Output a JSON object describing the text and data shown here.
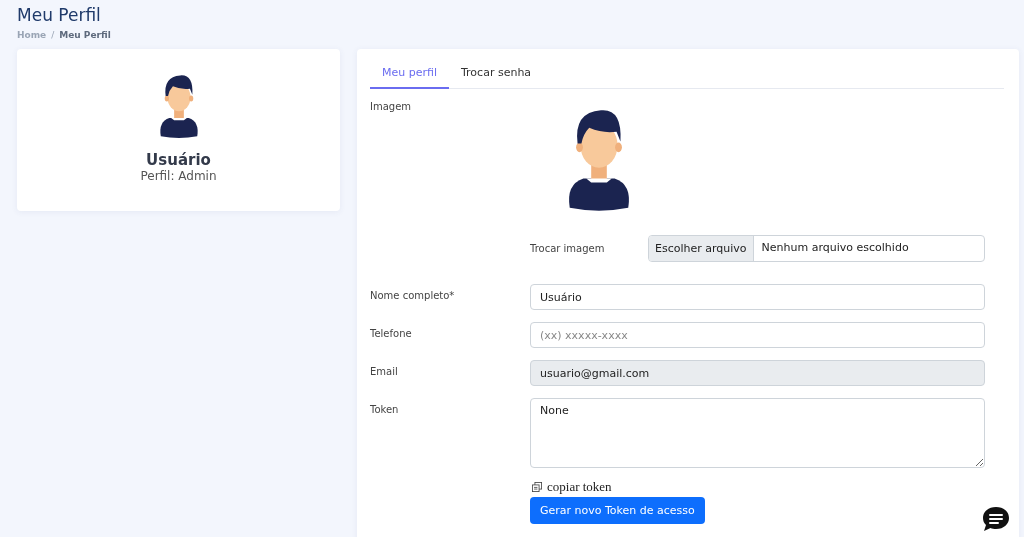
{
  "page": {
    "title": "Meu Perfil"
  },
  "breadcrumb_separator": "/",
  "breadcrumb": [
    {
      "label": "Home",
      "current": false
    },
    {
      "label": "Meu Perfil",
      "current": true
    }
  ],
  "profile_card": {
    "name": "Usuário",
    "role": "Perfil: Admin"
  },
  "tabs": [
    {
      "label": "Meu perfil",
      "selected": true
    },
    {
      "label": "Trocar senha",
      "selected": false
    }
  ],
  "image_section": {
    "label": "Imagem",
    "change_label": "Trocar imagem",
    "file_button": "Escolher arquivo",
    "file_status": "Nenhum arquivo escolhido"
  },
  "fields": [
    {
      "kind": "text",
      "label": "Nome completo*",
      "value": "Usuário",
      "disabled": false
    },
    {
      "kind": "text",
      "label": "Telefone",
      "placeholder": "(xx) xxxxx-xxxx",
      "disabled": false
    },
    {
      "kind": "text",
      "label": "Email",
      "value": "usuario@gmail.com",
      "disabled": true
    },
    {
      "kind": "textarea",
      "label": "Token",
      "value": "None",
      "disabled": false
    }
  ],
  "copy_link": "copiar token",
  "generate_button": "Gerar novo Token de acesso"
}
